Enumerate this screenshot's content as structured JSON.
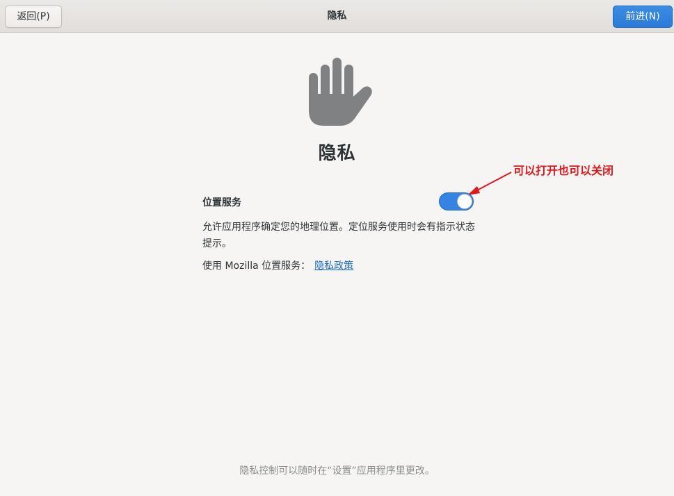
{
  "header": {
    "title": "隐私",
    "back_label": "返回(P)",
    "next_label": "前进(N)"
  },
  "hero": {
    "icon": "raised-hand-icon",
    "title": "隐私"
  },
  "location_service": {
    "label": "位置服务",
    "enabled": true,
    "description": "允许应用程序确定您的地理位置。定位服务使用时会有指示状态提示。",
    "mozilla_prefix": "使用 Mozilla 位置服务：",
    "policy_link": "隐私政策"
  },
  "annotation": {
    "text": "可以打开也可以关闭",
    "color": "#e0161a"
  },
  "footer": {
    "note": "隐私控制可以随时在“设置”应用程序里更改。"
  },
  "colors": {
    "accent": "#3584e4",
    "background": "#f6f5f4",
    "annotation": "#e0161a"
  }
}
